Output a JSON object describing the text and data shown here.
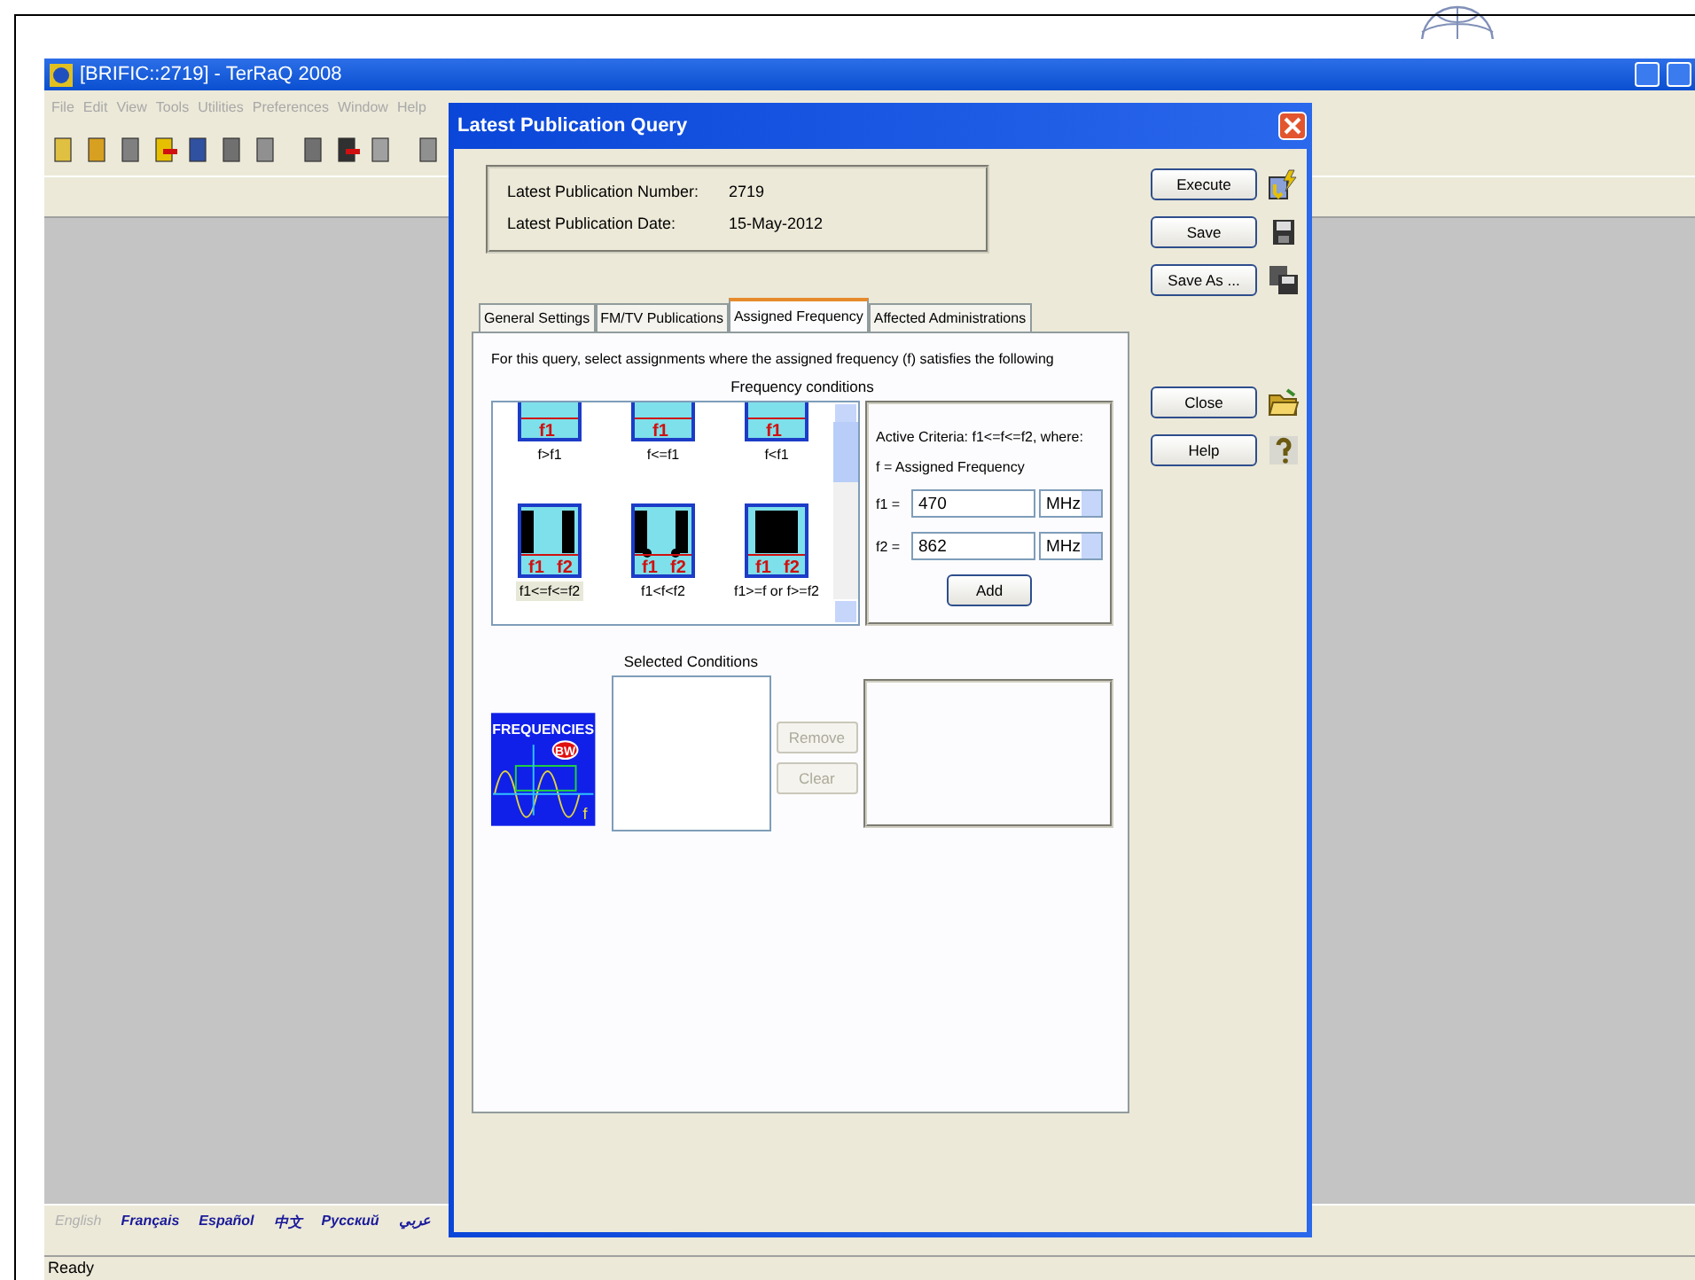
{
  "app": {
    "title": "[BRIFIC::2719] - TerRaQ 2008",
    "menu": [
      "File",
      "Edit",
      "View",
      "Tools",
      "Utilities",
      "Preferences",
      "Window",
      "Help"
    ],
    "languages": [
      {
        "label": "English",
        "selected": true
      },
      {
        "label": "Français",
        "selected": false
      },
      {
        "label": "Español",
        "selected": false
      },
      {
        "label": "中文",
        "selected": false
      },
      {
        "label": "Русский",
        "selected": false
      },
      {
        "label": "عربي",
        "selected": false
      }
    ],
    "status_bar": "Ready"
  },
  "dialog": {
    "title": "Latest Publication Query",
    "info": [
      {
        "label": "Latest Publication Number:",
        "value": "2719"
      },
      {
        "label": "Latest Publication Date:",
        "value": "15-May-2012"
      }
    ],
    "tabs": [
      {
        "label": "General Settings",
        "selected": false
      },
      {
        "label": "FM/TV Publications",
        "selected": false
      },
      {
        "label": "Assigned Frequency",
        "selected": true
      },
      {
        "label": "Affected Administrations",
        "selected": false
      }
    ],
    "intro": "For this query, select assignments where the assigned frequency (f) satisfies the following",
    "conditions_heading": "Frequency conditions",
    "conditions": [
      {
        "kind": "gt",
        "label": "f>f1",
        "marks": [
          "f1"
        ],
        "selected": false
      },
      {
        "kind": "le",
        "label": "f<=f1",
        "marks": [
          "f1"
        ],
        "selected": false
      },
      {
        "kind": "lt",
        "label": "f<f1",
        "marks": [
          "f1"
        ],
        "selected": false
      },
      {
        "kind": "between_incl",
        "label": "f1<=f<=f2",
        "marks": [
          "f1",
          "f2"
        ],
        "selected": true
      },
      {
        "kind": "between_excl",
        "label": "f1<f<f2",
        "marks": [
          "f1",
          "f2"
        ],
        "selected": false
      },
      {
        "kind": "outside",
        "label": "f1>=f or f>=f2",
        "marks": [
          "f1",
          "f2"
        ],
        "selected": false
      }
    ],
    "criteria": {
      "active": "Active Criteria: f1<=f<=f2, where:",
      "definition": "f =  Assigned Frequency",
      "fields": [
        {
          "label": "f1 =",
          "value": "470",
          "unit": "MHz"
        },
        {
          "label": "f2 =",
          "value": "862",
          "unit": "MHz"
        }
      ],
      "add_button": "Add"
    },
    "selected_heading": "Selected Conditions",
    "frequencies_image": {
      "title": "FREQUENCIES",
      "badge": "BW",
      "axis": "f"
    },
    "list_buttons": [
      {
        "label": "Remove",
        "disabled": true
      },
      {
        "label": "Clear",
        "disabled": true
      }
    ],
    "buttons": [
      {
        "label": "Execute",
        "kind": "execute"
      },
      {
        "label": "Save",
        "kind": "save"
      },
      {
        "label": "Save As ...",
        "kind": "saveas"
      },
      {
        "label": "Close",
        "kind": "close"
      },
      {
        "label": "Help",
        "kind": "help"
      }
    ]
  }
}
